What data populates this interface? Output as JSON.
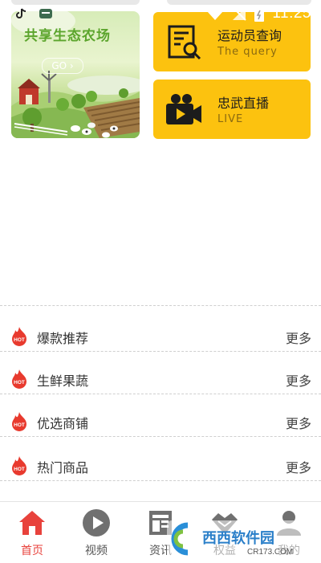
{
  "status_bar": {
    "time": "11:25"
  },
  "farm_card": {
    "title": "共享生态农场",
    "go_label": "GO"
  },
  "feature_cards": [
    {
      "title": "运动员查询",
      "subtitle": "The query",
      "icon": "document-search-icon"
    },
    {
      "title": "忠武直播",
      "subtitle": "LIVE",
      "icon": "video-camera-icon"
    }
  ],
  "list_rows": [
    {
      "badge": "HOT",
      "label": "爆款推荐",
      "more": "更多"
    },
    {
      "badge": "HOT",
      "label": "生鲜果蔬",
      "more": "更多"
    },
    {
      "badge": "HOT",
      "label": "优选商铺",
      "more": "更多"
    },
    {
      "badge": "HOT",
      "label": "热门商品",
      "more": "更多"
    }
  ],
  "bottom_nav": [
    {
      "label": "首页",
      "icon": "home-icon",
      "active": true
    },
    {
      "label": "视频",
      "icon": "play-icon",
      "active": false
    },
    {
      "label": "资讯",
      "icon": "news-icon",
      "active": false
    },
    {
      "label": "权益",
      "icon": "handshake-icon",
      "active": false
    },
    {
      "label": "我的",
      "icon": "user-icon",
      "active": false
    }
  ],
  "watermark": {
    "brand": "西西软件园",
    "site": "CR173.COM"
  },
  "colors": {
    "accent": "#fcc20f",
    "active_nav": "#e8423c",
    "hot_badge": "#e83a2e",
    "farm_title": "#5ca52d"
  }
}
